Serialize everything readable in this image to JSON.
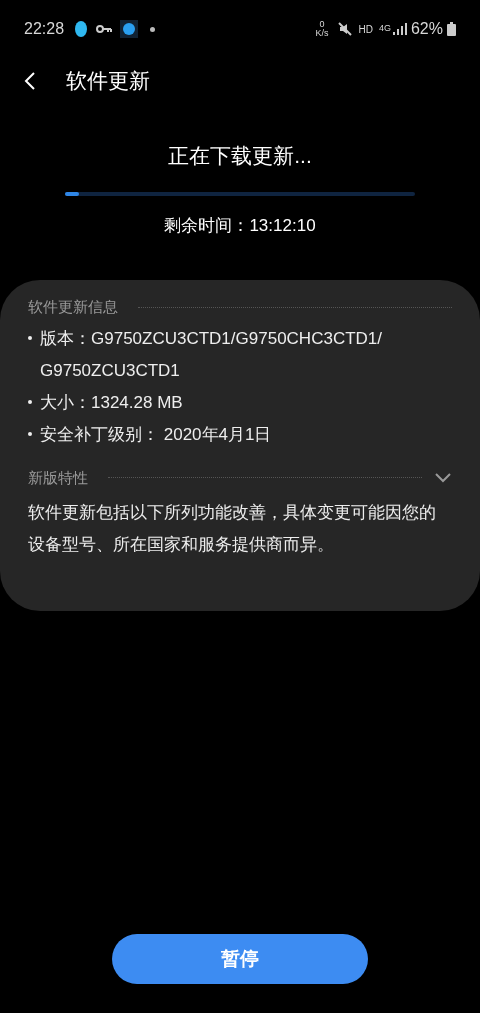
{
  "status_bar": {
    "time": "22:28",
    "net_speed_value": "0",
    "net_speed_unit": "K/s",
    "hd": "HD",
    "network": "4G",
    "battery": "62%"
  },
  "header": {
    "title": "软件更新"
  },
  "download": {
    "title": "正在下载更新...",
    "level": 0.04,
    "remaining": "剩余时间：13:12:10"
  },
  "info": {
    "heading": "软件更新信息",
    "items": [
      "版本：G9750ZCU3CTD1/G9750CHC3CTD1/\nG9750ZCU3CTD1",
      "大小：1324.28 MB",
      "安全补丁级别： 2020年4月1日"
    ]
  },
  "features": {
    "heading": "新版特性",
    "expanded": false,
    "text": "软件更新包括以下所列功能改善，具体变更可能因您的设备型号、所在国家和服务提供商而异。"
  },
  "button": {
    "label": "暂停"
  }
}
